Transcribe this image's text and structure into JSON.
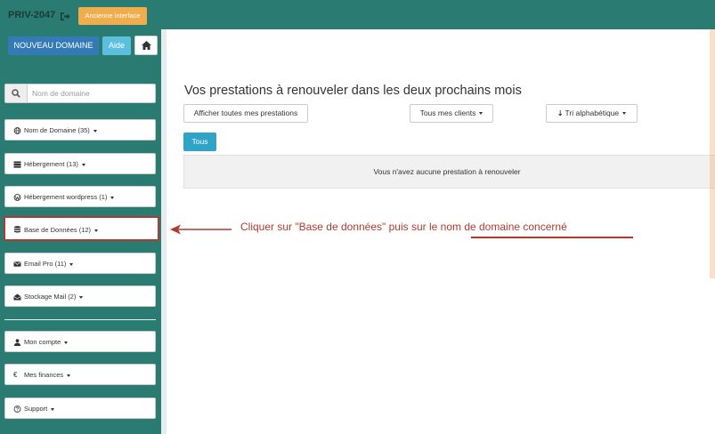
{
  "topbar": {
    "account": "PRIV-2047",
    "old_interface_label": "Ancienne interface"
  },
  "sidebar": {
    "new_domain_label": "NOUVEAU DOMAINE",
    "help_label": "Aide",
    "search_placeholder": "Nom de domaine",
    "items": [
      {
        "label": "Nom de Domaine (35)",
        "icon": "globe-icon"
      },
      {
        "label": "Hébergement (13)",
        "icon": "server-icon"
      },
      {
        "label": "Hébergement wordpress (1)",
        "icon": "wordpress-icon"
      },
      {
        "label": "Base de Données (12)",
        "icon": "database-icon"
      },
      {
        "label": "Email Pro (11)",
        "icon": "envelope-icon"
      },
      {
        "label": "Stockage Mail (2)",
        "icon": "envelope-open-icon"
      },
      {
        "label": "Mon compte",
        "icon": "user-icon"
      },
      {
        "label": "Mes finances",
        "icon": "euro-icon"
      },
      {
        "label": "Support",
        "icon": "question-icon"
      }
    ]
  },
  "main": {
    "title": "Vos prestations à renouveler dans les deux prochains mois",
    "show_all_label": "Afficher toutes mes prestations",
    "clients_filter": "Tous mes clients",
    "sort_label": "Tri alphabétique",
    "tab_all": "Tous",
    "empty_message": "Vous n'avez aucune prestation à renouveler"
  },
  "annotation": {
    "text_before": "Cliquer sur \"Base de données\" puis sur l",
    "text_underlined": "e nom de domaine concerné",
    "color": "#b03a2e"
  },
  "colors": {
    "sidebar": "#2a7b71",
    "primary": "#337ab7",
    "info": "#5bc0de",
    "warning": "#f0ad4e",
    "tab_active": "#2fa4c7"
  }
}
